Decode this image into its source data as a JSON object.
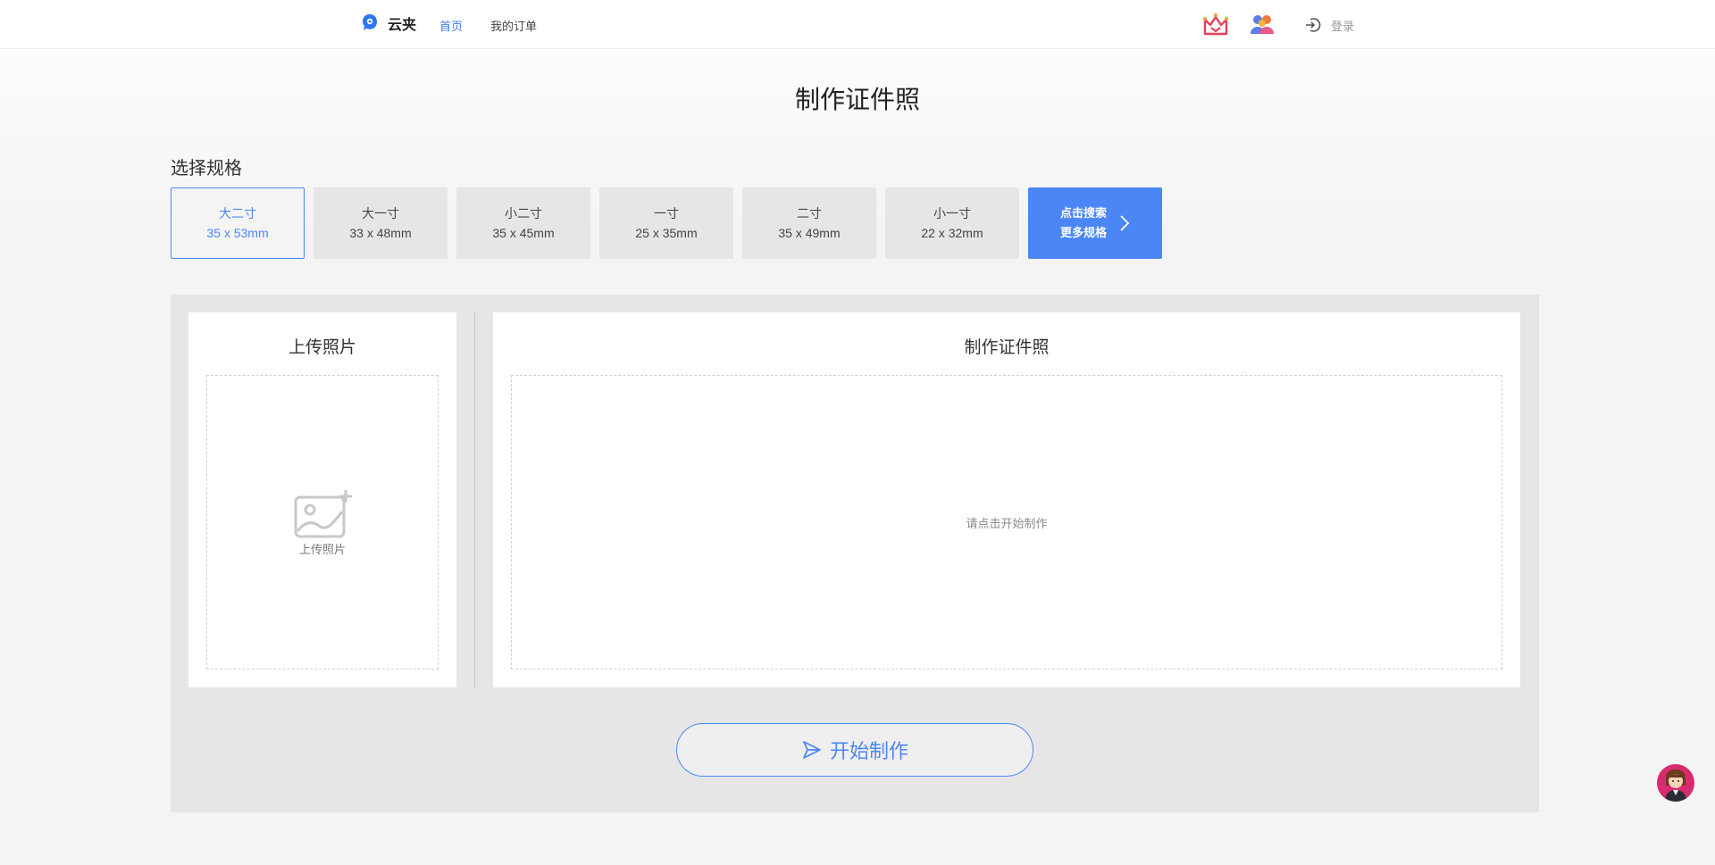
{
  "header": {
    "brand": "云夹",
    "nav": [
      {
        "label": "首页",
        "active": true
      },
      {
        "label": "我的订单",
        "active": false
      }
    ],
    "login_label": "登录"
  },
  "page_title": "制作证件照",
  "spec_section_label": "选择规格",
  "specs": [
    {
      "name": "大二寸",
      "size": "35 x 53mm",
      "selected": true
    },
    {
      "name": "大一寸",
      "size": "33 x 48mm"
    },
    {
      "name": "小二寸",
      "size": "35 x 45mm"
    },
    {
      "name": "一寸",
      "size": "25 x 35mm"
    },
    {
      "name": "二寸",
      "size": "35 x 49mm"
    },
    {
      "name": "小一寸",
      "size": "22 x 32mm"
    }
  ],
  "more_specs": {
    "line1": "点击搜索",
    "line2": "更多规格"
  },
  "upload_panel": {
    "title": "上传照片",
    "hint": "上传照片"
  },
  "result_panel": {
    "title": "制作证件照",
    "placeholder": "请点击开始制作"
  },
  "start_button": "开始制作",
  "colors": {
    "accent": "#4b86f7",
    "work_bg": "#e6e6e6",
    "nav_active": "#3d7cf1"
  },
  "icons": [
    "logo-icon",
    "crown-icon",
    "members-icon",
    "login-icon",
    "chevron-right-icon",
    "image-upload-icon",
    "send-icon",
    "support-avatar-icon"
  ]
}
